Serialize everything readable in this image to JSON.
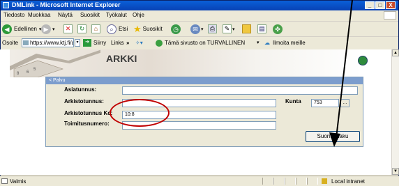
{
  "window": {
    "title": "DMLink - Microsoft Internet Explorer",
    "minimize": "_",
    "maximize": "□",
    "close": "X"
  },
  "menu": [
    "Tiedosto",
    "Muokkaa",
    "Näytä",
    "Suosikit",
    "Työkalut",
    "Ohje"
  ],
  "toolbar": {
    "back_label": "Edellinen",
    "search_label": "Etsi",
    "favorites_label": "Suosikit"
  },
  "addressbar": {
    "label": "Osoite",
    "url": "https://www.ktj.fi/ar",
    "go_label": "Siirry",
    "links_label": "Links",
    "safe_label": "Tämä sivusto on TURVALLINEN",
    "report_label": "Ilmoita meille"
  },
  "page": {
    "brand": "ARKKI",
    "panel_header": "< Palvu",
    "fields": [
      {
        "label": "Asiatunnus:",
        "value": ""
      },
      {
        "label": "Arkistotunnus:",
        "value": ""
      },
      {
        "label": "Arkistotunnus Kc:",
        "value": "10:8"
      },
      {
        "label": "Toimitusnumero:",
        "value": ""
      }
    ],
    "kunta_label": "Kunta",
    "kunta_value": "753",
    "browse_label": "...",
    "search_button": "Suorita haku"
  },
  "statusbar": {
    "status": "Valmis",
    "zone": "Local intranet"
  },
  "colors": {
    "annotation": "#c00000",
    "titlebar": "#0a5fd8",
    "panel_header": "#7c9dcd"
  }
}
